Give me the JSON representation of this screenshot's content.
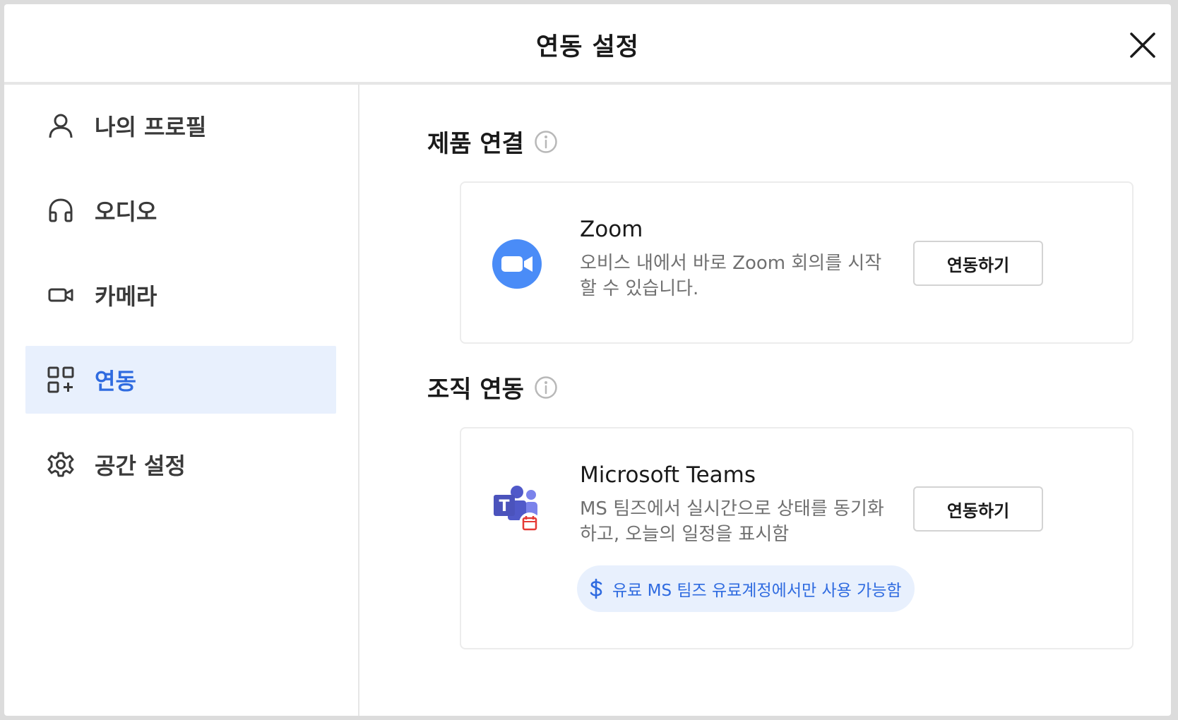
{
  "header": {
    "title": "연동 설정"
  },
  "sidebar": {
    "items": [
      {
        "label": "나의 프로필",
        "icon": "user-icon"
      },
      {
        "label": "오디오",
        "icon": "headphones-icon"
      },
      {
        "label": "카메라",
        "icon": "camera-icon"
      },
      {
        "label": "연동",
        "icon": "integrations-icon",
        "active": true
      },
      {
        "label": "공간 설정",
        "icon": "gear-icon"
      }
    ]
  },
  "main": {
    "product_section": {
      "title": "제품 연결",
      "card": {
        "name": "Zoom",
        "description": "오비스 내에서 바로 Zoom 회의를 시작할 수 있습니다.",
        "button_label": "연동하기"
      }
    },
    "org_section": {
      "title": "조직 연동",
      "card": {
        "name": "Microsoft Teams",
        "description": "MS 팀즈에서 실시간으로 상태를 동기화하고, 오늘의 일정을 표시함",
        "button_label": "연동하기",
        "badge": "유료 MS 팀즈 유료계정에서만 사용 가능함"
      }
    }
  },
  "colors": {
    "accent": "#2f6be0",
    "active_bg": "#e8f0fd",
    "zoom": "#4a8cf7",
    "teams": "#5059c9"
  }
}
